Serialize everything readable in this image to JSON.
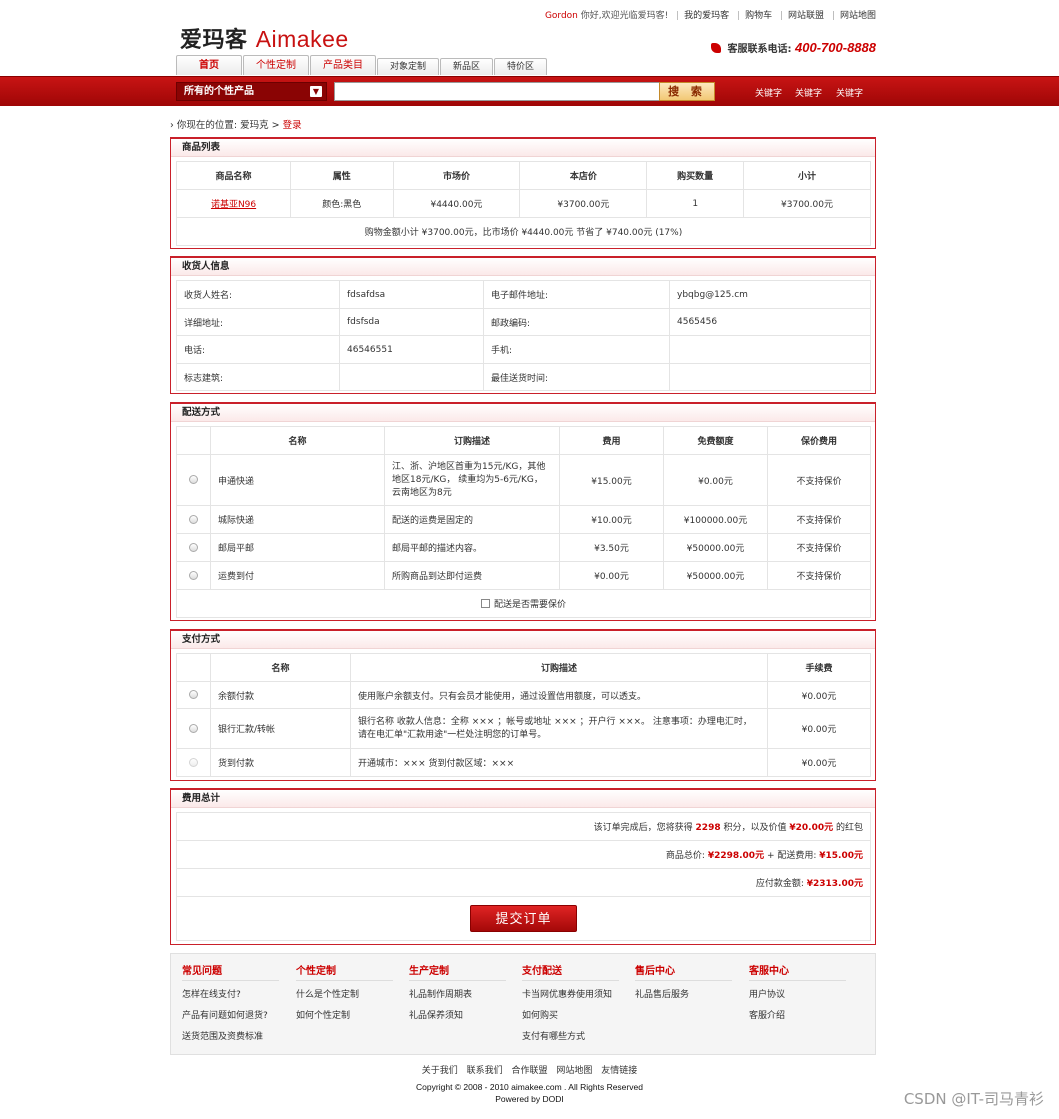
{
  "topbar": {
    "user": "Gordon",
    "greeting": "你好,欢迎光临爱玛客!",
    "links": [
      "我的爱玛客",
      "购物车",
      "网站联盟",
      "网站地图"
    ]
  },
  "logo": {
    "cn": "爱玛客",
    "en": "Aimakee"
  },
  "hotline": {
    "label": "客服联系电话:",
    "number": "400-700-8888"
  },
  "nav_tabs": [
    "首页",
    "个性定制",
    "产品类目",
    "对象定制",
    "新品区",
    "特价区"
  ],
  "search": {
    "category": "所有的个性产品",
    "button": "搜 索",
    "keywords": [
      "关键字",
      "关键字",
      "关键字"
    ]
  },
  "breadcrumb": {
    "prefix": "你现在的位置:",
    "home": "爱玛克",
    "current": "登录"
  },
  "goods": {
    "title": "商品列表",
    "headers": [
      "商品名称",
      "属性",
      "市场价",
      "本店价",
      "购买数量",
      "小计"
    ],
    "rows": [
      {
        "name": "诺基亚N96",
        "attr": "颜色:黑色",
        "market": "¥4440.00元",
        "price": "¥3700.00元",
        "qty": "1",
        "subtotal": "¥3700.00元"
      }
    ],
    "summary": "购物金额小计 ¥3700.00元，比市场价 ¥4440.00元 节省了 ¥740.00元 (17%)"
  },
  "consignee": {
    "title": "收货人信息",
    "rows": [
      {
        "l1": "收货人姓名:",
        "v1": "fdsafdsa",
        "l2": "电子邮件地址:",
        "v2": "ybqbg@125.cm"
      },
      {
        "l1": "详细地址:",
        "v1": "fdsfsda",
        "l2": "邮政编码:",
        "v2": "4565456"
      },
      {
        "l1": "电话:",
        "v1": "46546551",
        "l2": "手机:",
        "v2": ""
      },
      {
        "l1": "标志建筑:",
        "v1": "",
        "l2": "最佳送货时间:",
        "v2": ""
      }
    ]
  },
  "shipping": {
    "title": "配送方式",
    "headers": [
      "名称",
      "订购描述",
      "费用",
      "免费额度",
      "保价费用"
    ],
    "rows": [
      {
        "name": "申通快递",
        "desc": "江、浙、沪地区首重为15元/KG，其他地区18元/KG， 续重均为5-6元/KG， 云南地区为8元",
        "fee": "¥15.00元",
        "free": "¥0.00元",
        "insure": "不支持保价"
      },
      {
        "name": "城际快递",
        "desc": "配送的运费是固定的",
        "fee": "¥10.00元",
        "free": "¥100000.00元",
        "insure": "不支持保价"
      },
      {
        "name": "邮局平邮",
        "desc": "邮局平邮的描述内容。",
        "fee": "¥3.50元",
        "free": "¥50000.00元",
        "insure": "不支持保价"
      },
      {
        "name": "运费到付",
        "desc": "所购商品到达即付运费",
        "fee": "¥0.00元",
        "free": "¥50000.00元",
        "insure": "不支持保价"
      }
    ],
    "insure_label": "配送是否需要保价"
  },
  "payment": {
    "title": "支付方式",
    "headers": [
      "名称",
      "订购描述",
      "手续费"
    ],
    "rows": [
      {
        "name": "余额付款",
        "desc": "使用账户余额支付。只有会员才能使用，通过设置信用额度，可以透支。",
        "fee": "¥0.00元"
      },
      {
        "name": "银行汇款/转帐",
        "desc": "银行名称 收款人信息：全称 ××× ；帐号或地址 ××× ；开户行 ×××。 注意事项：办理电汇时，请在电汇单\"汇款用途\"一栏处注明您的订单号。",
        "fee": "¥0.00元"
      },
      {
        "name": "货到付款",
        "desc": "开通城市：××× 货到付款区域：×××",
        "fee": "¥0.00元"
      }
    ]
  },
  "totals": {
    "title": "费用总计",
    "points_pre": "该订单完成后，您将获得",
    "points": "2298",
    "points_mid": "积分，以及价值",
    "bonus": "¥20.00元",
    "points_post": "的红包",
    "goods_label": "商品总价:",
    "goods_total": "¥2298.00元",
    "ship_label": "+ 配送费用:",
    "ship_fee": "¥15.00元",
    "pay_label": "应付款金额:",
    "pay_total": "¥2313.00元",
    "submit": "提交订单"
  },
  "footer": {
    "columns": [
      {
        "title": "常见问题",
        "items": [
          "怎样在线支付?",
          "产品有问题如何退货?",
          "送货范围及资费标准"
        ]
      },
      {
        "title": "个性定制",
        "items": [
          "什么是个性定制",
          "如何个性定制"
        ]
      },
      {
        "title": "生产定制",
        "items": [
          "礼品制作周期表",
          "礼品保养须知"
        ]
      },
      {
        "title": "支付配送",
        "items": [
          "卡当网优惠券使用须知",
          "如何购买",
          "支付有哪些方式"
        ]
      },
      {
        "title": "售后中心",
        "items": [
          "礼品售后服务"
        ]
      },
      {
        "title": "客服中心",
        "items": [
          "用户协议",
          "客服介绍"
        ]
      }
    ],
    "nav": [
      "关于我们",
      "联系我们",
      "合作联盟",
      "网站地图",
      "友情链接"
    ],
    "copyright": "Copyright © 2008 - 2010 aimakee.com . All Rights Reserved",
    "powered": "Powered by DODI"
  },
  "watermark": "CSDN @IT-司马青衫",
  "colors": {
    "brand_red": "#c81414",
    "accent": "#c00"
  }
}
